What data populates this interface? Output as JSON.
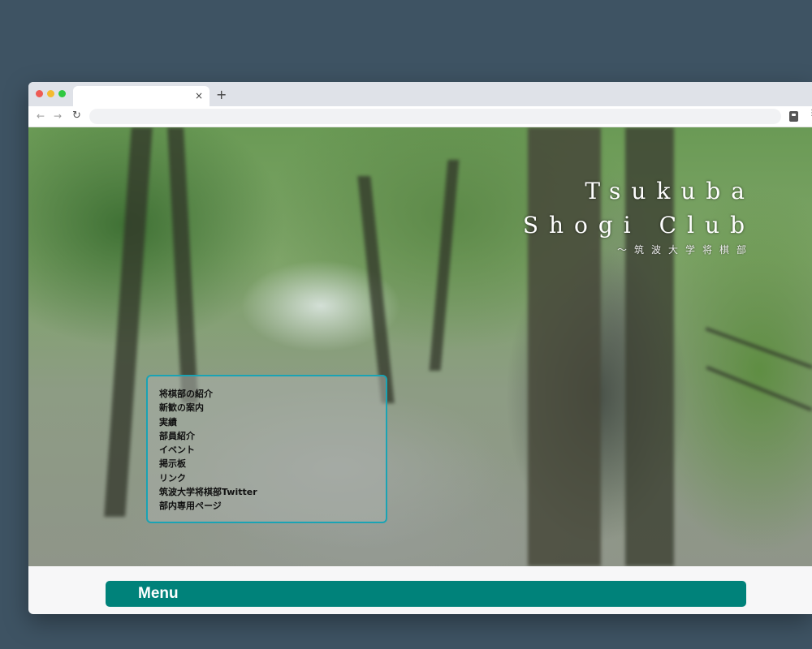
{
  "browser": {
    "tab_close": "×",
    "new_tab": "+",
    "back": "←",
    "forward": "→",
    "reload": "↻",
    "more": "⋮"
  },
  "hero": {
    "title_line1": "Tsukuba",
    "title_line2": "Shogi Club",
    "subtitle": "〜筑波大学将棋部"
  },
  "nav": {
    "items": [
      "将棋部の紹介",
      "新歓の案内",
      "実績",
      "部員紹介",
      "イベント",
      "掲示板",
      "リンク",
      "筑波大学将棋部Twitter",
      "部内専用ページ"
    ]
  },
  "menu": {
    "label": "Menu"
  },
  "colors": {
    "accent": "#00827a",
    "panel_border": "#1aa3b4",
    "desktop": "#3e5363"
  }
}
